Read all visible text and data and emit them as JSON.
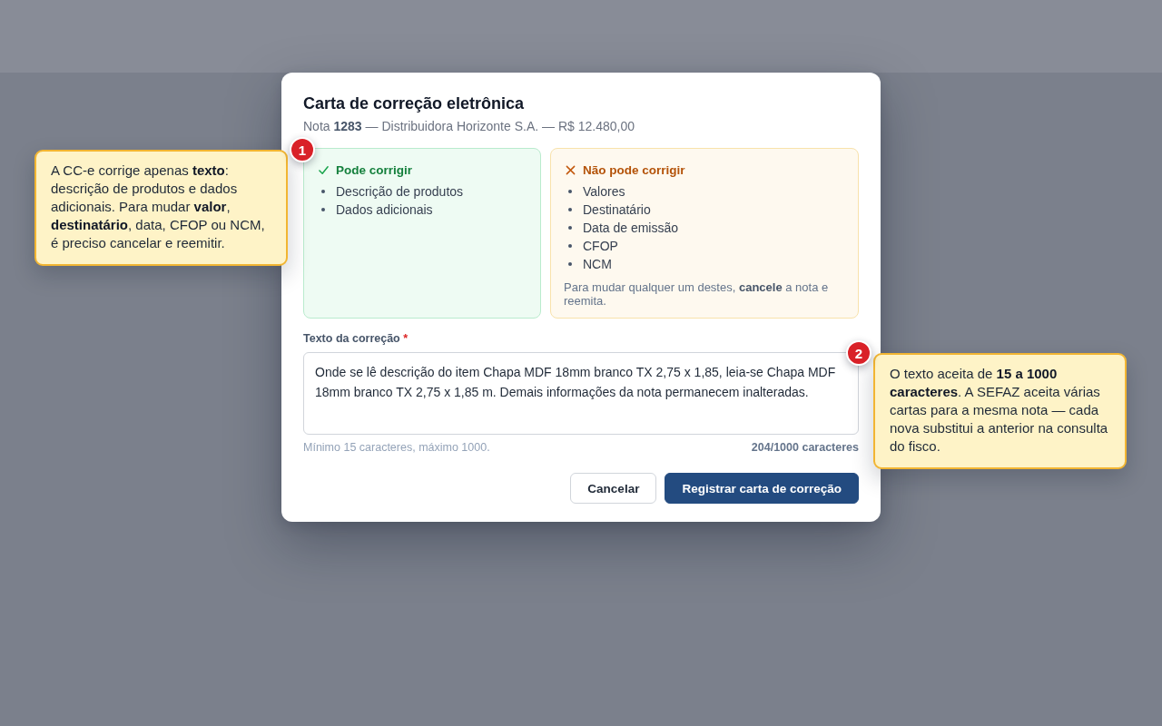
{
  "dialog": {
    "title": "Carta de correção eletrônica",
    "subtitle": "Nota **1283** — Distribuidora Horizonte S.A. — R$ 12.480,00",
    "panels": [
      {
        "kind": "allowed",
        "heading": "Pode corrigir",
        "items": [
          "Descrição de produtos",
          "Dados adicionais"
        ]
      },
      {
        "kind": "forbidden",
        "heading": "Não pode corrigir",
        "items": [
          "Valores",
          "Destinatário",
          "Data de emissão",
          "CFOP",
          "NCM"
        ],
        "note": "Para mudar qualquer um destes, **cancele** a nota e reemita."
      }
    ],
    "field": {
      "label": "Texto da correção",
      "required_mark": "*",
      "value": "Onde se lê descrição do item Chapa MDF 18mm branco TX 2,75 x 1,85, leia-se Chapa MDF 18mm branco TX 2,75 x 1,85 m. Demais informações da nota permanecem inalteradas.",
      "hint": "Mínimo 15 caracteres, máximo 1000.",
      "counter": "204/1000 caracteres"
    },
    "buttons": [
      {
        "label": "Cancelar",
        "kind": "secondary"
      },
      {
        "label": "Registrar carta de correção",
        "kind": "primary"
      }
    ]
  },
  "callouts": [
    {
      "number": "1",
      "text": "A CC-e corrige apenas **texto**: descrição de produtos e dados adicionais. Para mudar **valor**, **destinatário**, data, CFOP ou NCM, é preciso cancelar e reemitir."
    },
    {
      "number": "2",
      "text": "O texto aceita de **15 a 1000 caracteres**. A SEFAZ aceita várias cartas para a mesma nota — cada nova substitui a anterior na consulta do fisco."
    }
  ]
}
